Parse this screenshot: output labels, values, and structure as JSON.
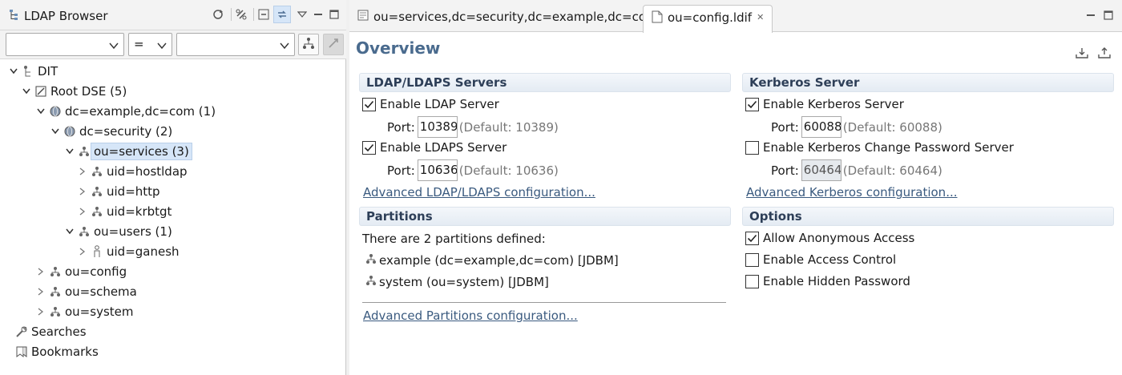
{
  "left_view": {
    "title": "LDAP Browser",
    "filter": {
      "attribute_value": "",
      "operator": "=",
      "value": ""
    },
    "tree": [
      {
        "label": "DIT",
        "twisty": "expanded",
        "icon": "dit-icon"
      },
      {
        "label": "Root DSE (5)",
        "twisty": "expanded",
        "icon": "rootdse-icon"
      },
      {
        "label": "dc=example,dc=com (1)",
        "twisty": "expanded",
        "icon": "globe-icon"
      },
      {
        "label": "dc=security (2)",
        "twisty": "expanded",
        "icon": "globe-icon"
      },
      {
        "label": "ou=services (3)",
        "twisty": "expanded",
        "icon": "ou-icon",
        "selected": true
      },
      {
        "label": "uid=hostldap",
        "twisty": "collapsed",
        "icon": "ou-icon"
      },
      {
        "label": "uid=http",
        "twisty": "collapsed",
        "icon": "ou-icon"
      },
      {
        "label": "uid=krbtgt",
        "twisty": "collapsed",
        "icon": "ou-icon"
      },
      {
        "label": "ou=users (1)",
        "twisty": "expanded",
        "icon": "ou-icon"
      },
      {
        "label": "uid=ganesh",
        "twisty": "collapsed",
        "icon": "person-icon"
      },
      {
        "label": "ou=config",
        "twisty": "collapsed",
        "icon": "ou-icon"
      },
      {
        "label": "ou=schema",
        "twisty": "collapsed",
        "icon": "ou-icon"
      },
      {
        "label": "ou=system",
        "twisty": "collapsed",
        "icon": "ou-icon"
      },
      {
        "label": "Searches",
        "twisty": "none",
        "icon": "search-icon"
      },
      {
        "label": "Bookmarks",
        "twisty": "none",
        "icon": "bookmark-icon"
      }
    ]
  },
  "editor": {
    "tabs": [
      {
        "label": "ou=services,dc=security,dc=example,dc=com",
        "active": false
      },
      {
        "label": "ou=config.ldif",
        "active": true
      }
    ],
    "title": "Overview",
    "ldap": {
      "heading": "LDAP/LDAPS Servers",
      "enable_ldap": {
        "label": "Enable LDAP Server",
        "checked": true
      },
      "ldap_port": {
        "label": "Port:",
        "value": "10389",
        "hint": "(Default: 10389)"
      },
      "enable_ldaps": {
        "label": "Enable LDAPS Server",
        "checked": true
      },
      "ldaps_port": {
        "label": "Port:",
        "value": "10636",
        "hint": "(Default: 10636)"
      },
      "advanced_link": "Advanced LDAP/LDAPS configuration..."
    },
    "kerberos": {
      "heading": "Kerberos Server",
      "enable_kerberos": {
        "label": "Enable Kerberos Server",
        "checked": true
      },
      "kerberos_port": {
        "label": "Port:",
        "value": "60088",
        "hint": "(Default: 60088)"
      },
      "enable_change_password": {
        "label": "Enable Kerberos Change Password Server",
        "checked": false
      },
      "change_password_port": {
        "label": "Port:",
        "value": "60464",
        "hint": "(Default: 60464)"
      },
      "advanced_link": "Advanced Kerberos configuration..."
    },
    "partitions": {
      "heading": "Partitions",
      "summary": "There are 2 partitions defined:",
      "items": [
        "example (dc=example,dc=com) [JDBM]",
        "system (ou=system) [JDBM]"
      ],
      "advanced_link": "Advanced Partitions configuration..."
    },
    "options": {
      "heading": "Options",
      "items": [
        {
          "label": "Allow Anonymous Access",
          "checked": true
        },
        {
          "label": "Enable Access Control",
          "checked": false
        },
        {
          "label": "Enable Hidden Password",
          "checked": false
        }
      ]
    }
  },
  "colors": {
    "title_blue": "#4a6b8e",
    "link_blue": "#3a5a7f",
    "selection": "#d6e6f8"
  }
}
